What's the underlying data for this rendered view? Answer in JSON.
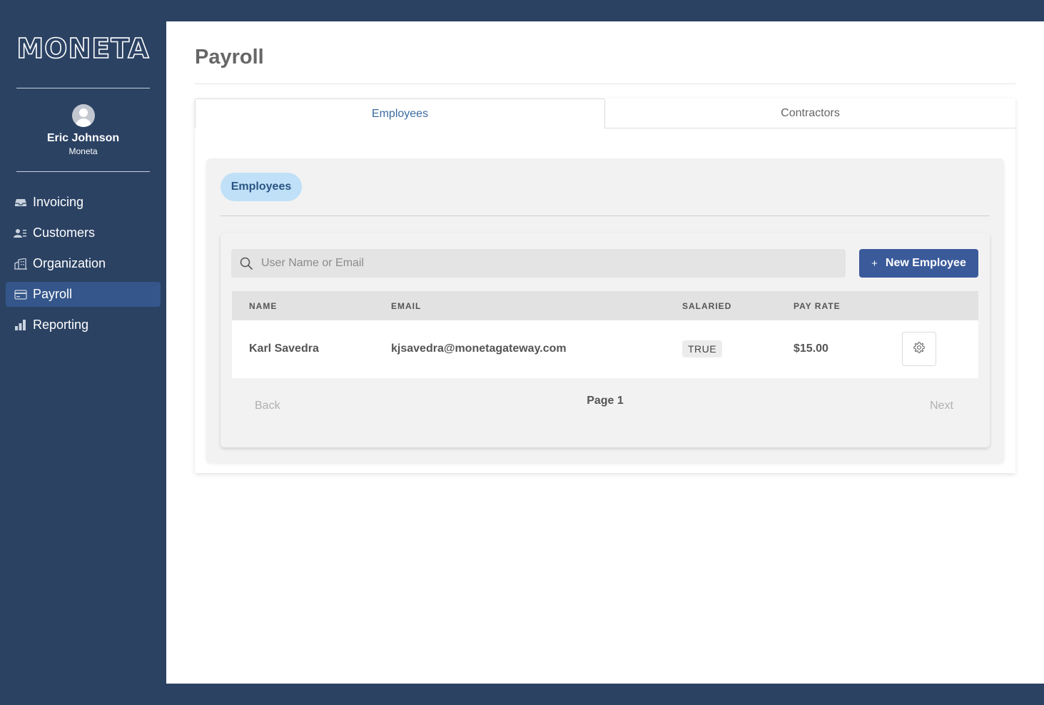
{
  "sidebar": {
    "logo": "MONETA",
    "user": {
      "name": "Eric Johnson",
      "org": "Moneta"
    },
    "items": [
      {
        "label": "Invoicing",
        "icon": "inbox-tray-icon"
      },
      {
        "label": "Customers",
        "icon": "users-list-icon"
      },
      {
        "label": "Organization",
        "icon": "building-icon"
      },
      {
        "label": "Payroll",
        "icon": "credit-card-icon",
        "active": true
      },
      {
        "label": "Reporting",
        "icon": "bar-chart-icon"
      }
    ]
  },
  "main": {
    "title": "Payroll",
    "tabs": [
      {
        "label": "Employees",
        "active": true
      },
      {
        "label": "Contractors",
        "active": false
      }
    ],
    "chip_label": "Employees",
    "search": {
      "placeholder": "User Name or Email",
      "value": ""
    },
    "new_button": {
      "icon": "+",
      "label": "New Employee"
    },
    "table": {
      "columns": [
        "NAME",
        "EMAIL",
        "SALARIED",
        "PAY RATE"
      ],
      "rows": [
        {
          "name": "Karl Savedra",
          "email": "kjsavedra@monetagateway.com",
          "salaried": "TRUE",
          "pay_rate": "$15.00"
        }
      ]
    },
    "pager": {
      "back": "Back",
      "label": "Page 1",
      "next": "Next"
    }
  },
  "colors": {
    "sidebar_bg": "#2b4263",
    "active_nav": "#34568a",
    "primary_button": "#3a5a9a",
    "chip_bg": "#bfe0f7",
    "tab_active_text": "#3a6aa0"
  }
}
